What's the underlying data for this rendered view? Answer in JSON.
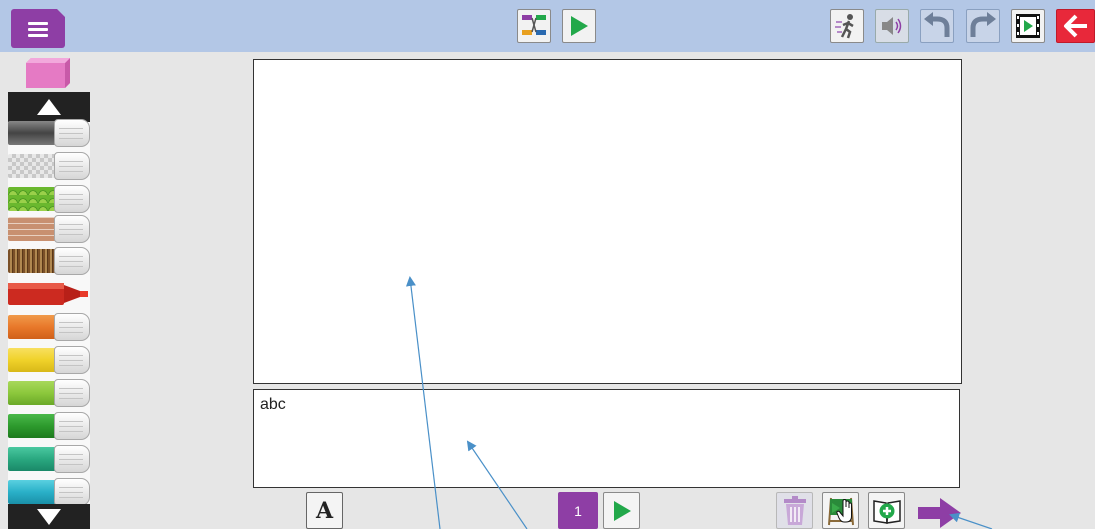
{
  "topbar": {
    "menu_icon": "hamburger-menu-icon",
    "center_buttons": [
      "storyboard-icon",
      "play-icon"
    ],
    "right_buttons": [
      "walking-figure-icon",
      "speaker-icon",
      "undo-icon",
      "redo-icon",
      "film-play-icon",
      "back-arrow-icon"
    ]
  },
  "palette": {
    "eraser_icon": "eraser-icon",
    "scroll_up_icon": "triangle-up-icon",
    "scroll_down_icon": "triangle-down-icon",
    "markers": [
      {
        "name": "gray",
        "color": "#666666"
      },
      {
        "name": "transparent",
        "color": "#cccccc"
      },
      {
        "name": "green-scales",
        "color": "#6ab82e"
      },
      {
        "name": "brick",
        "color": "#b07a5e"
      },
      {
        "name": "wood",
        "color": "#8a6235"
      },
      {
        "name": "red",
        "color": "#cc2a20"
      },
      {
        "name": "orange",
        "color": "#e8782a"
      },
      {
        "name": "yellow",
        "color": "#f0d22a"
      },
      {
        "name": "light-green",
        "color": "#8cc83c"
      },
      {
        "name": "green",
        "color": "#2d9a2d"
      },
      {
        "name": "teal",
        "color": "#2aa880"
      },
      {
        "name": "cyan",
        "color": "#2ab0c8"
      }
    ]
  },
  "text_panel": {
    "value": "abc"
  },
  "bottom": {
    "font_button_label": "A",
    "page_number": "1",
    "play_icon": "play-icon",
    "trash_icon": "trash-icon",
    "pan_canvas_icon": "easel-hand-icon",
    "add_page_icon": "add-page-icon",
    "next_arrow_icon": "next-arrow-icon"
  },
  "colors": {
    "accent_purple": "#8e3ea5",
    "play_green": "#22a84a",
    "topbar_blue": "#b3c7e6",
    "exit_red": "#e8283a",
    "annotation_arrow": "#4a90c8"
  }
}
